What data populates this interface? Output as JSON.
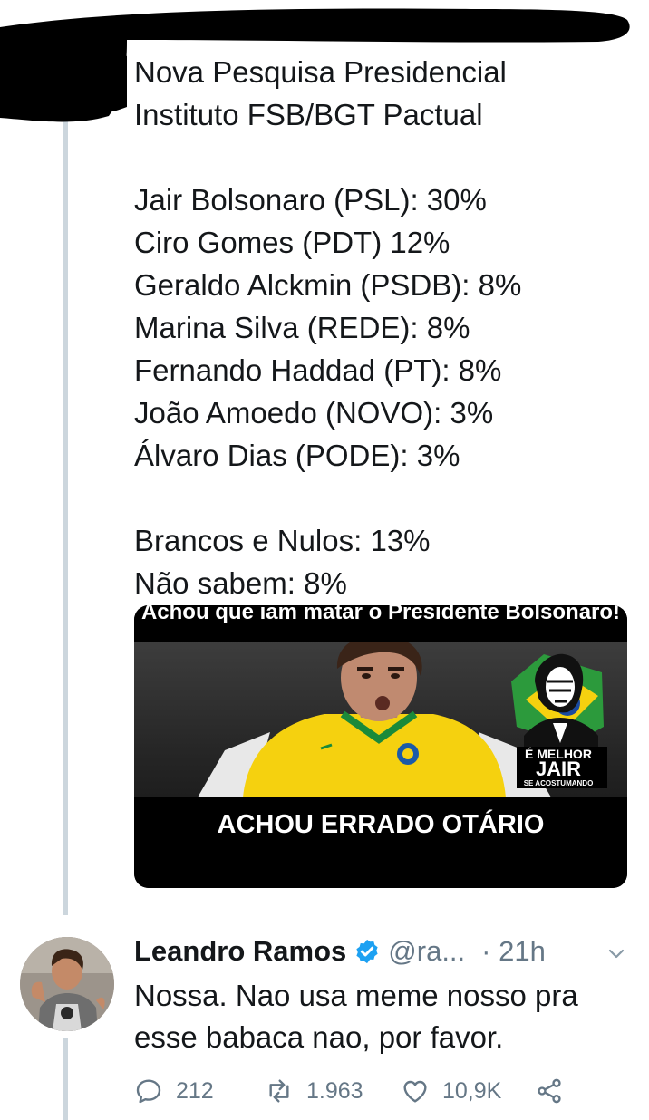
{
  "tweet": {
    "text": "Nova Pesquisa Presidencial\nInstituto FSB/BGT Pactual\n\nJair Bolsonaro (PSL): 30%\nCiro Gomes (PDT) 12%\nGeraldo Alckmin (PSDB): 8%\nMarina Silva (REDE): 8%\nFernando Haddad (PT): 8%\nJoão Amoedo (NOVO): 3%\nÁlvaro Dias (PODE): 3%\n\nBrancos e Nulos: 13%\nNão sabem: 8%",
    "media": {
      "top_caption": "Achou que iam matar o Presidente Bolsonaro!",
      "bottom_caption": "ACHOU ERRADO OTÁRIO",
      "logo_line1": "É MELHOR",
      "logo_line2": "JAIR",
      "logo_line3": "SE ACOSTUMANDO"
    }
  },
  "reply": {
    "name": "Leandro Ramos",
    "handle": "@ra...",
    "time": "· 21h",
    "text": "Nossa. Nao usa meme nosso pra esse babaca nao, por favor.",
    "actions": {
      "replies": "212",
      "retweets": "1.963",
      "likes": "10,9K"
    }
  },
  "colors": {
    "accent": "#1da1f2",
    "muted": "#657786",
    "thread_line": "#ccd6dd"
  }
}
